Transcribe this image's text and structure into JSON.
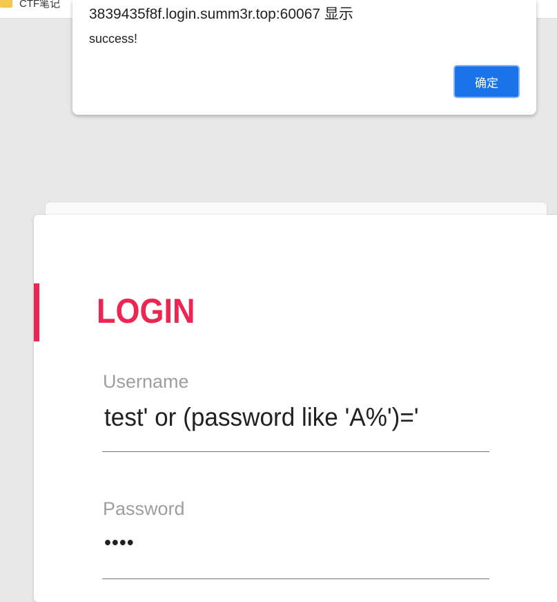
{
  "bookmarks_bar": {
    "items": [
      {
        "label": "CTF笔记",
        "icon": "folder-icon"
      }
    ]
  },
  "alert_dialog": {
    "title": "3839435f8f.login.summ3r.top:60067 显示",
    "message": "success!",
    "ok_label": "确定"
  },
  "login_form": {
    "title": "LOGIN",
    "username": {
      "label": "Username",
      "value": "test'  or  (password like 'A%')='"
    },
    "password": {
      "label": "Password",
      "value_masked": "••••"
    }
  },
  "colors": {
    "accent": "#ed2553",
    "dialog_button": "#1a73e8",
    "background": "#e8e8e8"
  }
}
